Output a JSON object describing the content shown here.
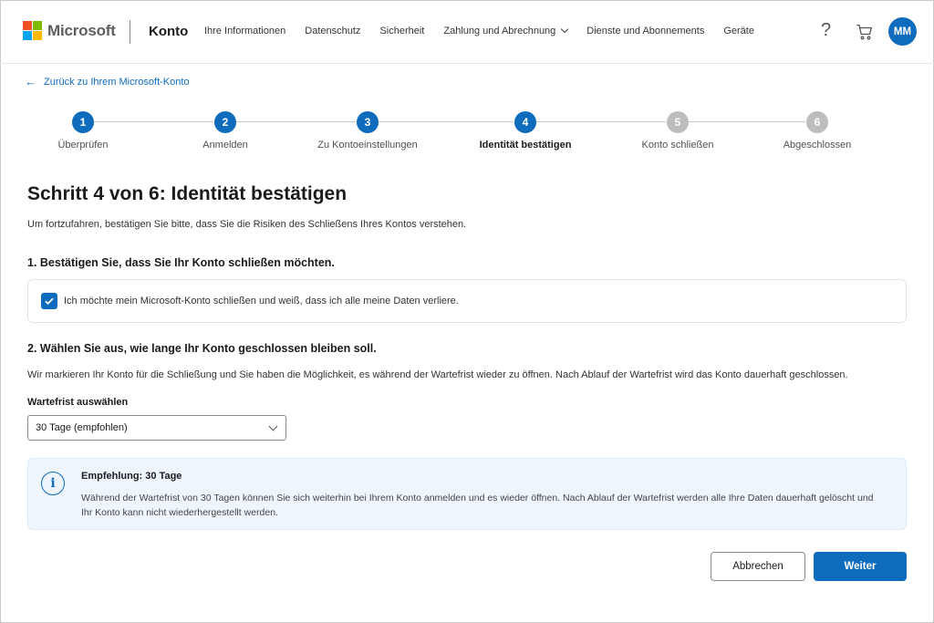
{
  "header": {
    "brand": "Microsoft",
    "section": "Konto",
    "nav": [
      {
        "label": "Ihre Informationen"
      },
      {
        "label": "Datenschutz"
      },
      {
        "label": "Sicherheit"
      },
      {
        "label": "Zahlung und Abrechnung",
        "dropdown": true
      },
      {
        "label": "Dienste und Abonnements"
      },
      {
        "label": "Geräte"
      }
    ],
    "help_icon": "?",
    "avatar_initials": "MM",
    "logo_colors": [
      "#f25022",
      "#7fba00",
      "#00a4ef",
      "#ffb900"
    ]
  },
  "back_link": "Zurück zu Ihrem Microsoft-Konto",
  "stepper": {
    "steps": [
      {
        "number": "1",
        "label": "Überprüfen",
        "state": "done"
      },
      {
        "number": "2",
        "label": "Anmelden",
        "state": "done"
      },
      {
        "number": "3",
        "label": "Zu Kontoeinstellungen",
        "state": "done"
      },
      {
        "number": "4",
        "label": "Identität bestätigen",
        "state": "current"
      },
      {
        "number": "5",
        "label": "Konto schließen",
        "state": "upcoming"
      },
      {
        "number": "6",
        "label": "Abgeschlossen",
        "state": "upcoming"
      }
    ]
  },
  "page": {
    "title": "Schritt 4 von 6: Identität bestätigen",
    "subtitle": "Um fortzufahren, bestätigen Sie bitte, dass Sie die Risiken des Schließens Ihres Kontos verstehen.",
    "section1_heading": "1. Bestätigen Sie, dass Sie Ihr Konto schließen möchten.",
    "confirm_checkbox_label": "Ich möchte mein Microsoft-Konto schließen und weiß, dass ich alle meine Daten verliere.",
    "confirm_checked": true,
    "section2_heading": "2. Wählen Sie aus, wie lange Ihr Konto geschlossen bleiben soll.",
    "section2_description": "Wir markieren Ihr Konto für die Schließung und Sie haben die Möglichkeit, es während der Wartefrist wieder zu öffnen. Nach Ablauf der Wartefrist wird das Konto dauerhaft geschlossen.",
    "waiting_period_label": "Wartefrist auswählen",
    "waiting_period_value": "30 Tage (empfohlen)",
    "info": {
      "title": "Empfehlung: 30 Tage",
      "text": "Während der Wartefrist von 30 Tagen können Sie sich weiterhin bei Ihrem Konto anmelden und es wieder öffnen. Nach Ablauf der Wartefrist werden alle Ihre Daten dauerhaft gelöscht und Ihr Konto kann nicht wiederhergestellt werden."
    }
  },
  "buttons": {
    "cancel": "Abbrechen",
    "next": "Weiter"
  },
  "colors": {
    "accent": "#0f6cbd",
    "step_inactive": "#bdbdbd",
    "info_bg": "#eef5fc"
  }
}
